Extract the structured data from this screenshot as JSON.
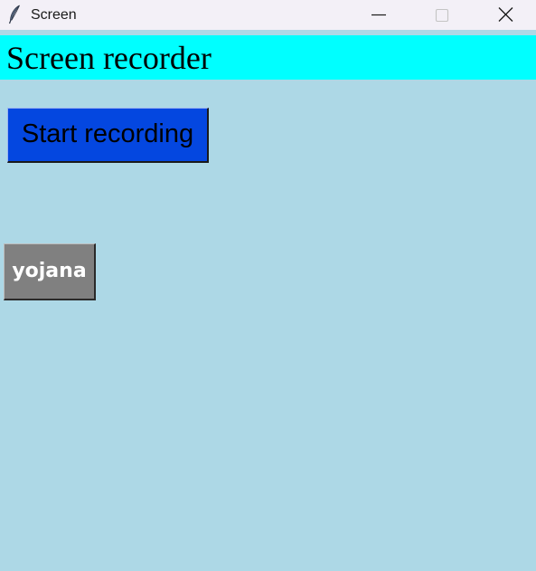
{
  "window": {
    "title": "Screen",
    "app_icon": "feather-icon",
    "controls": {
      "minimize_icon": "minimize-icon",
      "maximize_icon": "maximize-icon",
      "close_icon": "close-icon"
    }
  },
  "header": {
    "title": "Screen recorder",
    "background_color": "#00ffff"
  },
  "buttons": {
    "start_recording": "Start recording",
    "yojana": "yojana"
  },
  "colors": {
    "window_background": "#add8e6",
    "start_button_background": "#0447e0",
    "yojana_button_background": "#808080"
  }
}
